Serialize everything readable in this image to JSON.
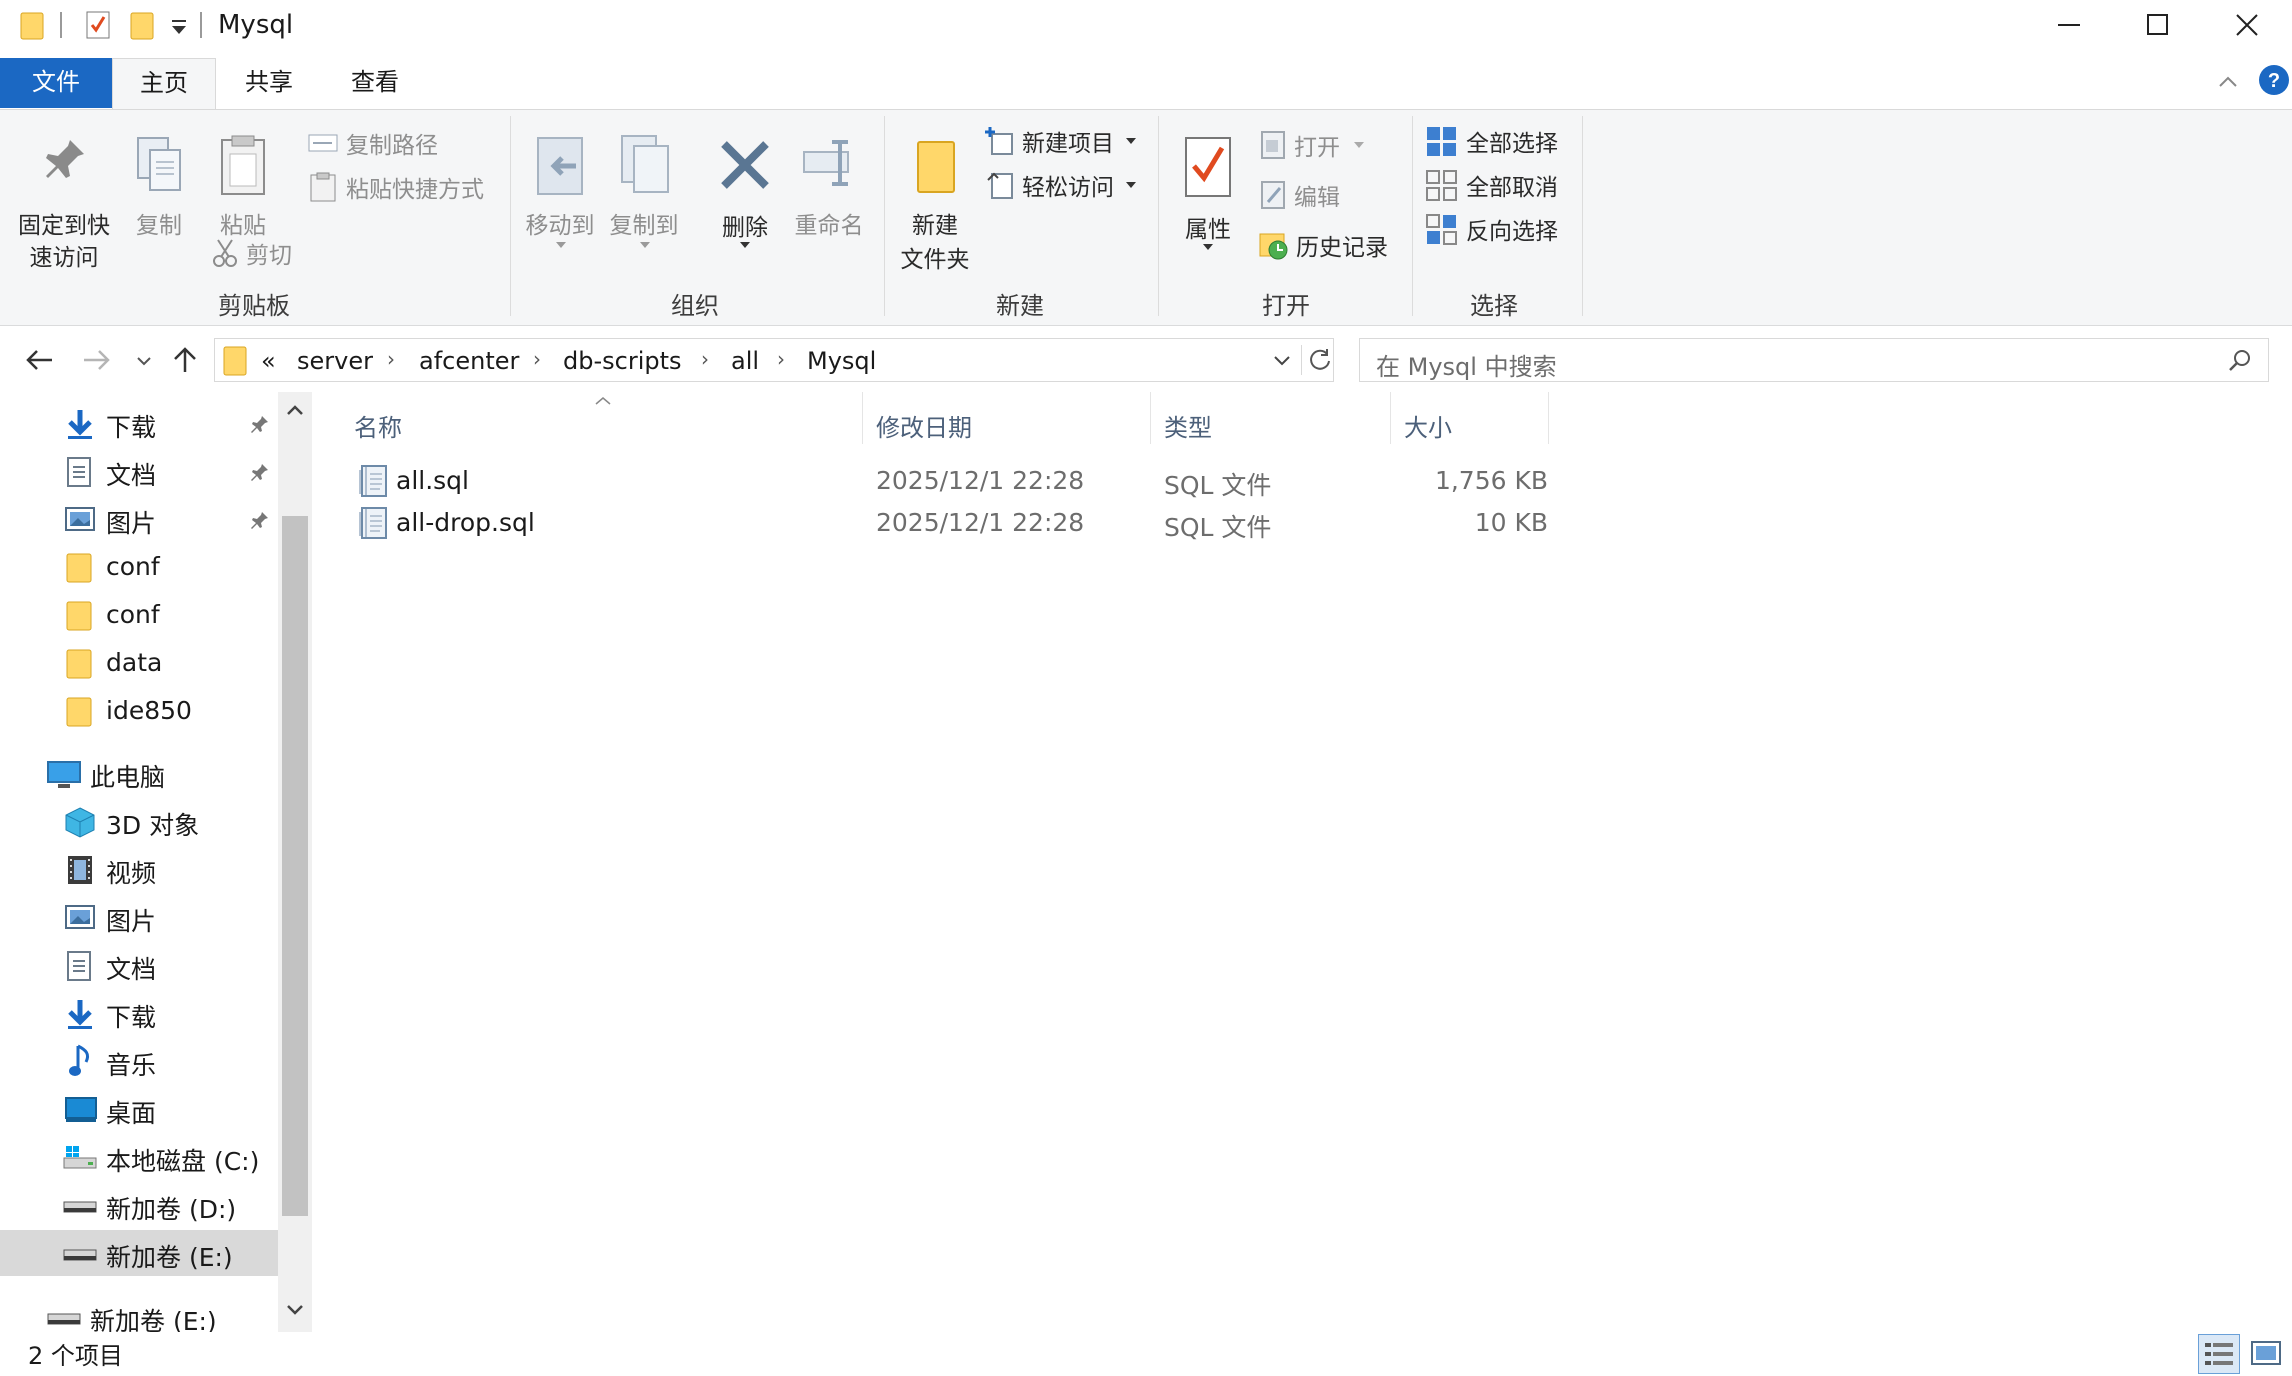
{
  "window": {
    "title": "Mysql",
    "controls": {
      "minimize": "minimize-icon",
      "maximize": "maximize-icon",
      "close": "close-icon"
    }
  },
  "tabs": [
    {
      "label": "文件"
    },
    {
      "label": "主页"
    },
    {
      "label": "共享"
    },
    {
      "label": "查看"
    }
  ],
  "ribbon": {
    "clipboard": {
      "pin_line1": "固定到快",
      "pin_line2": "速访问",
      "copy": "复制",
      "paste": "粘贴",
      "copy_path": "复制路径",
      "paste_shortcut": "粘贴快捷方式",
      "cut": "剪切",
      "label": "剪贴板"
    },
    "organize": {
      "move_to": "移动到",
      "copy_to": "复制到",
      "delete": "删除",
      "rename": "重命名",
      "label": "组织"
    },
    "new": {
      "new_folder_line1": "新建",
      "new_folder_line2": "文件夹",
      "new_item": "新建项目",
      "easy_access": "轻松访问",
      "label": "新建"
    },
    "open": {
      "properties": "属性",
      "open": "打开",
      "edit": "编辑",
      "history": "历史记录",
      "label": "打开"
    },
    "select": {
      "select_all": "全部选择",
      "select_none": "全部取消",
      "invert": "反向选择",
      "label": "选择"
    }
  },
  "address": {
    "overflow": "«",
    "crumbs": [
      "server",
      "afcenter",
      "db-scripts",
      "all",
      "Mysql"
    ],
    "search_placeholder": "在 Mysql 中搜索"
  },
  "nav": {
    "items": [
      {
        "label": "下载",
        "icon": "download-icon",
        "pinned": true
      },
      {
        "label": "文档",
        "icon": "document-icon",
        "pinned": true
      },
      {
        "label": "图片",
        "icon": "picture-icon",
        "pinned": true
      },
      {
        "label": "conf",
        "icon": "folder-icon"
      },
      {
        "label": "conf",
        "icon": "folder-icon"
      },
      {
        "label": "data",
        "icon": "folder-icon"
      },
      {
        "label": "ide850",
        "icon": "folder-icon"
      },
      {
        "label": "此电脑",
        "icon": "computer-icon"
      },
      {
        "label": "3D 对象",
        "icon": "3d-objects-icon"
      },
      {
        "label": "视频",
        "icon": "video-icon"
      },
      {
        "label": "图片",
        "icon": "picture-icon"
      },
      {
        "label": "文档",
        "icon": "document-icon"
      },
      {
        "label": "下载",
        "icon": "download-icon"
      },
      {
        "label": "音乐",
        "icon": "music-icon"
      },
      {
        "label": "桌面",
        "icon": "desktop-icon"
      },
      {
        "label": "本地磁盘 (C:)",
        "icon": "system-drive-icon"
      },
      {
        "label": "新加卷 (D:)",
        "icon": "drive-icon"
      },
      {
        "label": "新加卷 (E:)",
        "icon": "drive-icon",
        "selected": true
      },
      {
        "label": "新加卷 (E:)",
        "icon": "drive-icon"
      }
    ]
  },
  "columns": {
    "name": "名称",
    "modified": "修改日期",
    "type": "类型",
    "size": "大小"
  },
  "files": [
    {
      "name": "all.sql",
      "modified": "2025/12/1 22:28",
      "type": "SQL 文件",
      "size": "1,756 KB"
    },
    {
      "name": "all-drop.sql",
      "modified": "2025/12/1 22:28",
      "type": "SQL 文件",
      "size": "10 KB"
    }
  ],
  "status": {
    "count": "2 个项目"
  },
  "colors": {
    "accent": "#1b68c3",
    "folder": "#ffd76a",
    "header_text": "#4c607a",
    "selected": "#d9d9d9"
  }
}
